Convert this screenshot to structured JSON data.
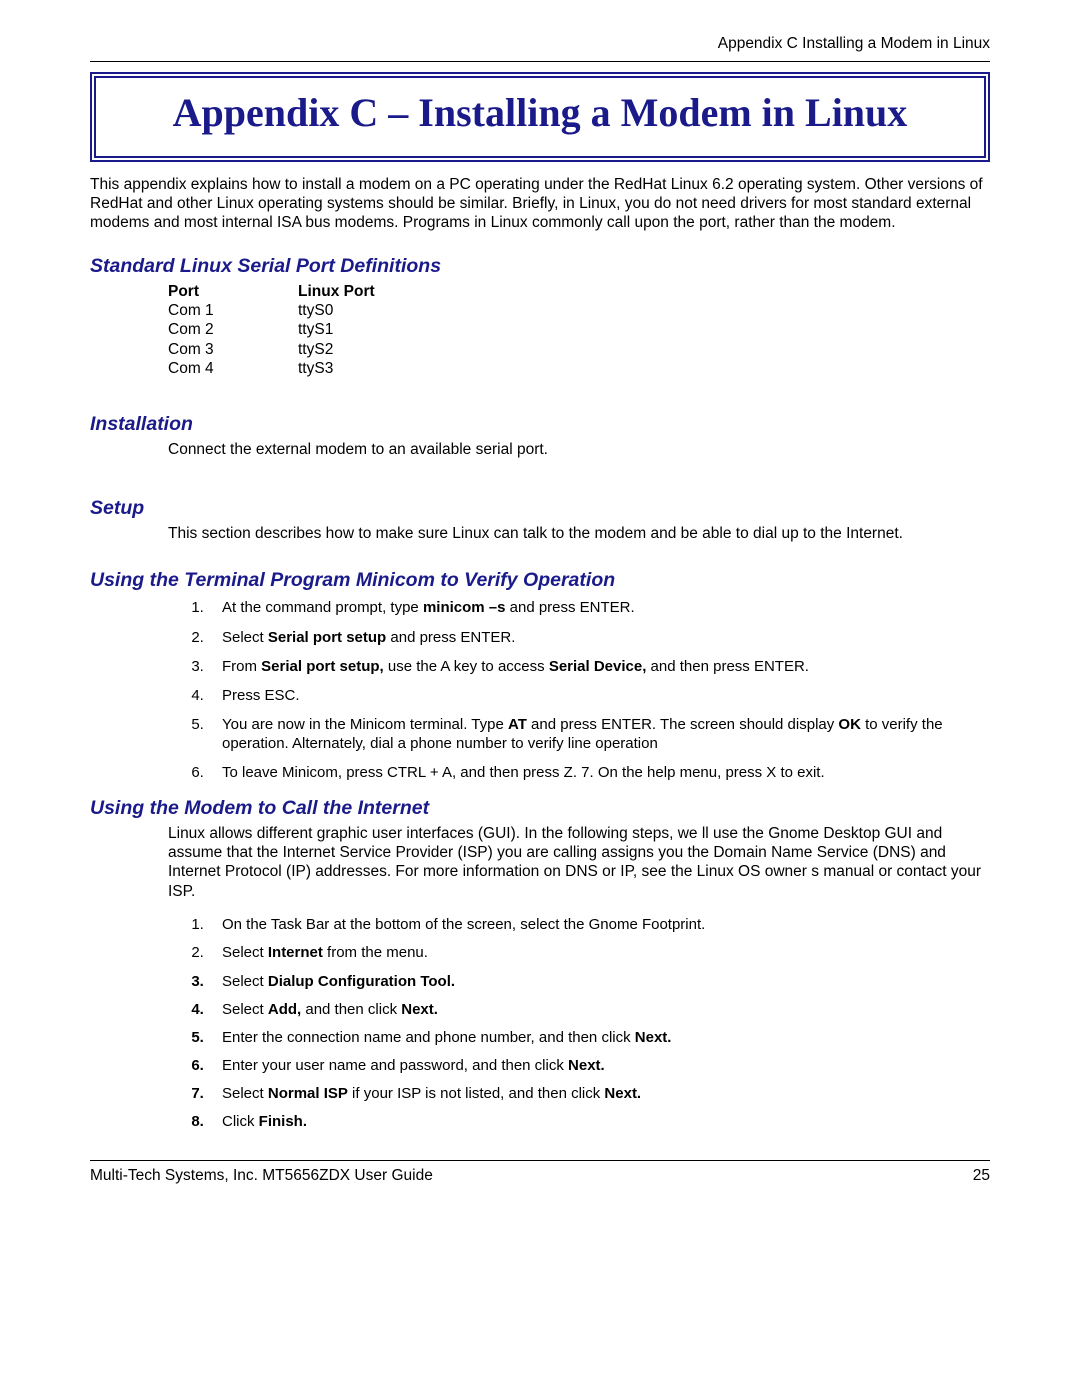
{
  "running_head": "Appendix C   Installing a Modem in Linux",
  "title": "Appendix C – Installing a Modem in Linux",
  "intro": "This appendix explains how to install a modem on a PC operating under the RedHat Linux 6.2 operating system. Other versions of RedHat and other Linux operating systems should be similar. Briefly, in Linux, you do not need drivers for most standard external modems and most internal ISA bus modems. Programs in Linux commonly call upon the port, rather than the modem.",
  "sections": {
    "ports": {
      "heading": "Standard Linux Serial Port Definitions",
      "header1": "Port",
      "header2": "Linux Port",
      "rows": [
        {
          "c1": "Com 1",
          "c2": "ttyS0"
        },
        {
          "c1": "Com 2",
          "c2": "ttyS1"
        },
        {
          "c1": "Com 3",
          "c2": "ttyS2"
        },
        {
          "c1": "Com 4",
          "c2": "ttyS3"
        }
      ]
    },
    "installation": {
      "heading": "Installation",
      "text": "Connect the external modem to an available serial port."
    },
    "setup": {
      "heading": "Setup",
      "text": "This section describes how to make sure Linux can talk to the modem and be able to dial up to the Internet."
    },
    "minicom": {
      "heading": "Using the Terminal Program Minicom to Verify Operation",
      "steps": {
        "s1a": "At the command prompt, type ",
        "s1b": "minicom –s",
        "s1c": " and press ENTER.",
        "s2a": "Select ",
        "s2b": "Serial port setup",
        "s2c": " and press ENTER.",
        "s3a": "From ",
        "s3b": "Serial port setup,",
        "s3c": " use the A key to access ",
        "s3d": "Serial Device,",
        "s3e": " and then press ENTER.",
        "s4": "Press ESC.",
        "s5a": "You are now in the Minicom terminal. Type ",
        "s5b": "AT",
        "s5c": " and press ENTER. The screen should display ",
        "s5d": "OK",
        "s5e": " to verify the operation. Alternately, dial a phone number to verify line operation",
        "s6": "To leave Minicom, press CTRL + A, and then press Z. 7. On the help menu, press X to exit."
      }
    },
    "internet": {
      "heading": "Using the Modem to Call the Internet",
      "intro": "Linux allows different graphic user interfaces (GUI). In the following steps, we ll use the Gnome Desktop GUI and assume that the Internet Service Provider (ISP) you are calling assigns you the Domain Name Service (DNS) and Internet Protocol (IP) addresses. For more information on DNS or IP, see the Linux OS owner s manual or contact your ISP.",
      "steps": {
        "s1": "On the Task Bar at the bottom of the screen, select the Gnome Footprint.",
        "s2a": "Select ",
        "s2b": "Internet",
        "s2c": " from the menu.",
        "s3a": "Select ",
        "s3b": "Dialup Configuration Tool.",
        "s4a": "Select ",
        "s4b": "Add,",
        "s4c": " and then click ",
        "s4d": "Next.",
        "s5a": "Enter the connection name and phone number, and then click ",
        "s5b": "Next.",
        "s6a": "Enter your user name and password, and then click ",
        "s6b": "Next.",
        "s7a": "Select ",
        "s7b": "Normal ISP",
        "s7c": " if your ISP is not listed, and then click ",
        "s7d": "Next.",
        "s8a": "Click ",
        "s8b": "Finish."
      }
    }
  },
  "footer": {
    "left": "Multi-Tech Systems, Inc. MT5656ZDX User Guide",
    "right": "25"
  }
}
